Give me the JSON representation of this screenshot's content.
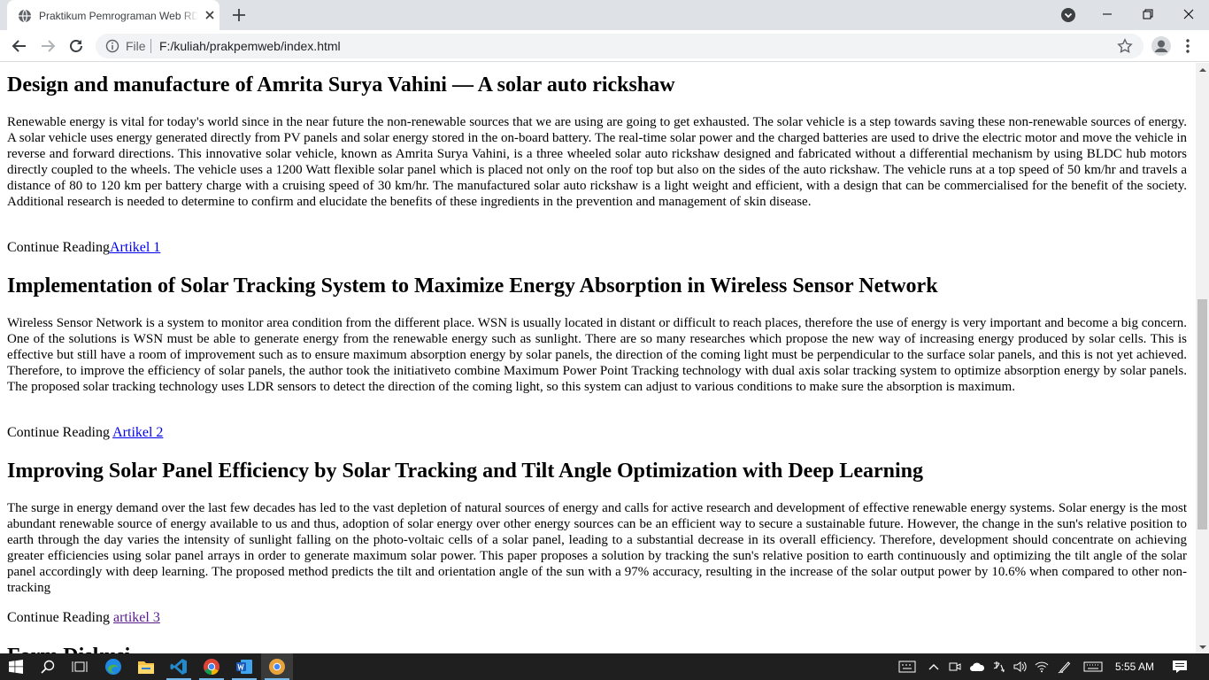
{
  "browser": {
    "tab": {
      "title": "Praktikum Pemrograman Web RD",
      "favicon": "globe-icon",
      "close_icon": "close-icon"
    },
    "new_tab_icon": "plus-icon",
    "window_controls": [
      "minimize-icon",
      "restore-icon",
      "close-icon"
    ],
    "tab_search_icon": "chevron-down-icon"
  },
  "toolbar": {
    "back_icon": "back-arrow-icon",
    "forward_icon": "forward-arrow-icon",
    "reload_icon": "reload-icon",
    "omnibox": {
      "scheme_label": "File",
      "url": "F:/kuliah/prakpemweb/index.html",
      "info_icon": "info-icon"
    },
    "bookmark_icon": "star-icon",
    "profile_icon": "profile-icon",
    "menu_icon": "kebab-menu-icon"
  },
  "page": {
    "articles": [
      {
        "title": "Design and manufacture of Amrita Surya Vahini — A solar auto rickshaw",
        "body": "Renewable energy is vital for today's world since in the near future the non-renewable sources that we are using are going to get exhausted. The solar vehicle is a step towards saving these non-renewable sources of energy. A solar vehicle uses energy generated directly from PV panels and solar energy stored in the on-board battery. The real-time solar power and the charged batteries are used to drive the electric motor and move the vehicle in reverse and forward directions. This innovative solar vehicle, known as Amrita Surya Vahini, is a three wheeled solar auto rickshaw designed and fabricated without a differential mechanism by using BLDC hub motors directly coupled to the wheels. The vehicle uses a 1200 Watt flexible solar panel which is placed not only on the roof top but also on the sides of the auto rickshaw. The vehicle runs at a top speed of 50 km/hr and travels a distance of 80 to 120 km per battery charge with a cruising speed of 30 km/hr. The manufactured solar auto rickshaw is a light weight and efficient, with a design that can be commercialised for the benefit of the society. Additional research is needed to determine to confirm and elucidate the benefits of these ingredients in the prevention and management of skin disease.",
        "more_label": "Continue Reading",
        "link": "Artikel 1"
      },
      {
        "title": "Implementation of Solar Tracking System to Maximize Energy Absorption in Wireless Sensor Network",
        "body": "Wireless Sensor Network is a system to monitor area condition from the different place. WSN is usually located in distant or difficult to reach places, therefore the use of energy is very important and become a big concern. One of the solutions is WSN must be able to generate energy from the renewable energy such as sunlight. There are so many researches which propose the new way of increasing energy produced by solar cells. This is effective but still have a room of improvement such as to ensure maximum absorption energy by solar panels, the direction of the coming light must be perpendicular to the surface solar panels, and this is not yet achieved. Therefore, to improve the efficiency of solar panels, the author took the initiativeto combine Maximum Power Point Tracking technology with dual axis solar tracking system to optimize absorption energy by solar panels. The proposed solar tracking technology uses LDR sensors to detect the direction of the coming light, so this system can adjust to various conditions to make sure the absorption is maximum.",
        "more_label": "Continue Reading ",
        "link": "Artikel 2"
      },
      {
        "title": "Improving Solar Panel Efficiency by Solar Tracking and Tilt Angle Optimization with Deep Learning",
        "body": "The surge in energy demand over the last few decades has led to the vast depletion of natural sources of energy and calls for active research and development of effective renewable energy systems. Solar energy is the most abundant renewable source of energy available to us and thus, adoption of solar energy over other energy sources can be an efficient way to secure a sustainable future. However, the change in the sun's relative position to earth through the day varies the intensity of sunlight falling on the photo-voltaic cells of a solar panel, leading to a substantial decrease in its overall efficiency. Therefore, development should concentrate on achieving greater efficiencies using solar panel arrays in order to generate maximum solar power. This paper proposes a solution by tracking the sun's relative position to earth continuously and optimizing the tilt angle of the solar panel accordingly with deep learning. The proposed method predicts the tilt and orientation angle of the sun with a 97% accuracy, resulting in the increase of the solar output power by 10.6% when compared to other non-tracking",
        "more_label": "Continue Reading ",
        "link": "artikel 3"
      }
    ],
    "next_heading": "Form Diskusi"
  },
  "scrollbar": {
    "position_fraction": 0.45
  },
  "taskbar": {
    "apps": [
      "windows-start-icon",
      "search-icon",
      "task-view-icon",
      "edge-icon",
      "file-explorer-icon",
      "vscode-icon",
      "chrome-icon",
      "word-icon",
      "chrome-canary-icon"
    ],
    "tray_icons": [
      "keyboard-touch-icon",
      "chevron-up-icon",
      "meet-now-icon",
      "onedrive-icon",
      "ime-icon",
      "volume-icon",
      "wifi-icon",
      "pen-icon",
      "keyboard-icon"
    ],
    "clock": "5:55 AM",
    "notification_icon": "notification-icon"
  },
  "colors": {
    "tabstrip_bg": "#dee1e6",
    "link": "#0000ee",
    "visited_link": "#551a8b",
    "taskbar_bg": "#1f1f1f"
  }
}
